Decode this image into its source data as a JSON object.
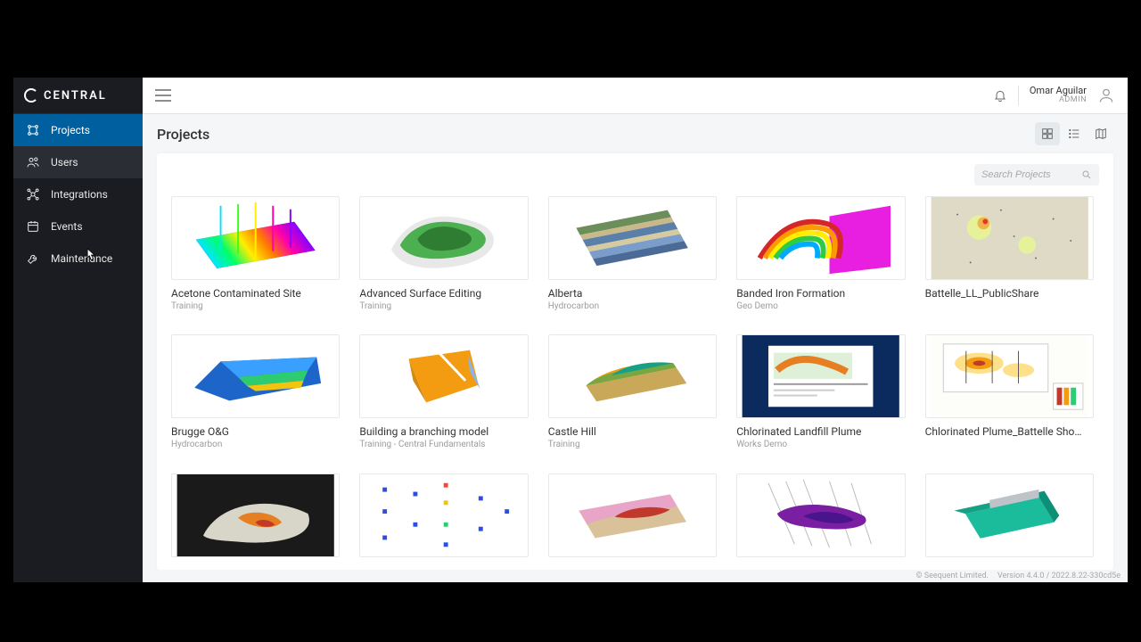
{
  "brand": {
    "name": "CENTRAL"
  },
  "sidebar": {
    "items": [
      {
        "label": "Projects"
      },
      {
        "label": "Users"
      },
      {
        "label": "Integrations"
      },
      {
        "label": "Events"
      },
      {
        "label": "Maintenance"
      }
    ],
    "activeIndex": 0,
    "hoverIndex": 1
  },
  "topbar": {
    "user_name": "Omar Aguilar",
    "user_role": "ADMIN"
  },
  "page": {
    "title": "Projects",
    "search_placeholder": "Search Projects"
  },
  "projects": [
    {
      "title": "Acetone Contaminated Site",
      "sub": "Training"
    },
    {
      "title": "Advanced Surface Editing",
      "sub": "Training"
    },
    {
      "title": "Alberta",
      "sub": "Hydrocarbon"
    },
    {
      "title": "Banded Iron Formation",
      "sub": "Geo Demo"
    },
    {
      "title": "Battelle_LL_PublicShare",
      "sub": ""
    },
    {
      "title": "Brugge O&G",
      "sub": "Hydrocarbon"
    },
    {
      "title": "Building a branching model",
      "sub": "Training - Central Fundamentals"
    },
    {
      "title": "Castle Hill",
      "sub": "Training"
    },
    {
      "title": "Chlorinated Landfill Plume",
      "sub": "Works Demo"
    },
    {
      "title": "Chlorinated Plume_Battelle Sho…",
      "sub": ""
    },
    {
      "title": "",
      "sub": ""
    },
    {
      "title": "",
      "sub": ""
    },
    {
      "title": "",
      "sub": ""
    },
    {
      "title": "",
      "sub": ""
    },
    {
      "title": "",
      "sub": ""
    }
  ],
  "footer": {
    "copyright": "© Seequent Limited.",
    "version": "Version 4.4.0 / 2022.8.22-330cd5e"
  }
}
